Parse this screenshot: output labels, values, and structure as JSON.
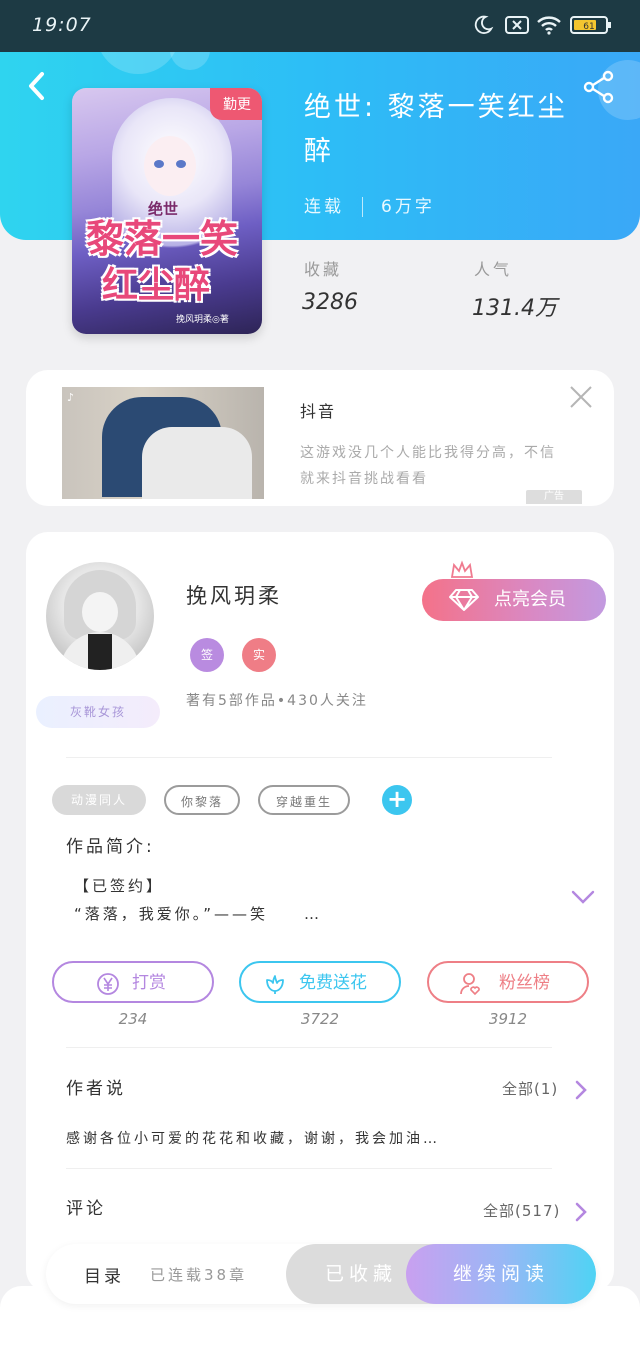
{
  "status_bar": {
    "time": "19:07",
    "battery": "61"
  },
  "book": {
    "badge": "勤更",
    "cover_small": "绝世",
    "cover_line1": "黎落一笑",
    "cover_line2": "红尘醉",
    "cover_author": "挽风玥柔◎著",
    "title": "绝世: 黎落一笑红尘醉",
    "status": "连载",
    "words": "6万字",
    "collect_label": "收藏",
    "collect_value": "3286",
    "popularity_label": "人气",
    "popularity_value": "131.4万"
  },
  "ad": {
    "name": "抖音",
    "desc": "这游戏没几个人能比我得分高，不信就来抖音挑战看看",
    "tag": "广告"
  },
  "author": {
    "name": "挽风玥柔",
    "badge1": "签",
    "badge2": "实",
    "title_tag": "灰靴女孩",
    "info": "著有5部作品•430人关注",
    "vip_button": "点亮会员"
  },
  "tags": [
    "动漫同人",
    "你黎落",
    "穿越重生"
  ],
  "intro": {
    "heading": "作品简介:",
    "line1": "【已签约】",
    "line2": "“落落，我爱你。”——笑　　…"
  },
  "actions": [
    {
      "label": "打赏",
      "count": "234",
      "color": "#b487e0"
    },
    {
      "label": "免费送花",
      "count": "3722",
      "color": "#3cc6ef"
    },
    {
      "label": "粉丝榜",
      "count": "3912",
      "color": "#ee7f86"
    }
  ],
  "author_say": {
    "heading": "作者说",
    "all": "全部(1)",
    "content": "感谢各位小可爱的花花和收藏，谢谢，我会加油…"
  },
  "comments": {
    "heading": "评论",
    "all": "全部(517)"
  },
  "bottom": {
    "toc": "目录",
    "chapters": "已连载38章",
    "favorited": "已收藏",
    "continue": "继续阅读"
  }
}
